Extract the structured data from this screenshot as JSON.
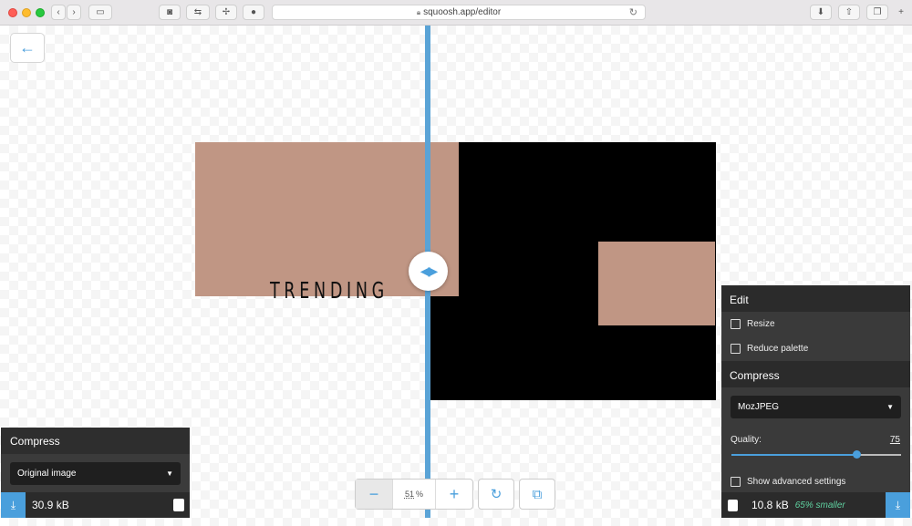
{
  "browser": {
    "url": "squoosh.app/editor"
  },
  "image": {
    "text": "TRENDING"
  },
  "left_panel": {
    "title": "Compress",
    "select_value": "Original image",
    "size": "30.9 kB"
  },
  "right_panel": {
    "edit_title": "Edit",
    "resize_label": "Resize",
    "reduce_palette_label": "Reduce palette",
    "compress_title": "Compress",
    "codec_value": "MozJPEG",
    "quality_label": "Quality:",
    "quality_value": "75",
    "quality": 75,
    "advanced_label": "Show advanced settings",
    "size": "10.8 kB",
    "savings": "65% smaller"
  },
  "zoom": {
    "value": "51",
    "unit": "%"
  },
  "colors": {
    "accent": "#4a9fdc",
    "panel": "#2b2b2b",
    "savings": "#5fd1a0",
    "image_tan": "#c09684"
  }
}
